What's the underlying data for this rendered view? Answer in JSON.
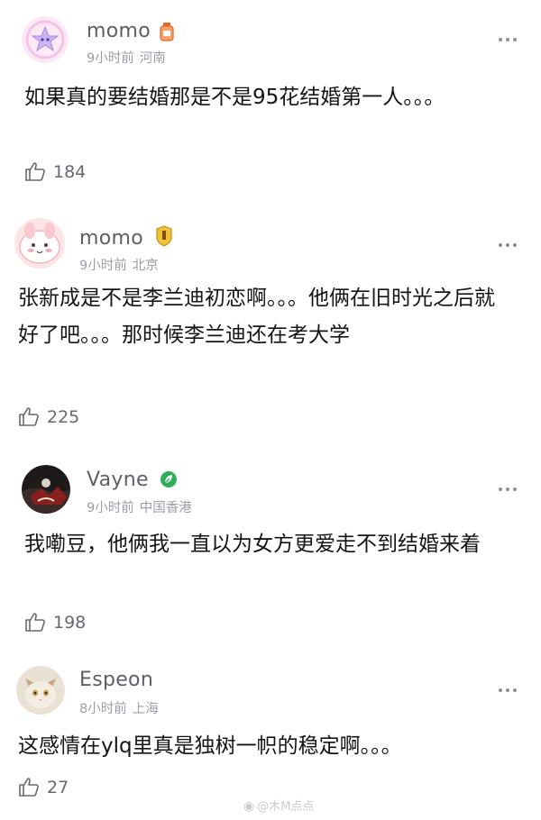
{
  "comments": [
    {
      "username": "momo",
      "time": "9小时前",
      "location": "河南",
      "text": "如果真的要结婚那是不是95花结婚第一人。。。",
      "likes": "184",
      "avatar_icon": "pastel-star-avatar",
      "badge_icon": "orange-bottle-badge-icon"
    },
    {
      "username": "momo",
      "time": "9小时前",
      "location": "北京",
      "text": "张新成是不是李兰迪初恋啊。。。他俩在旧时光之后就好了吧。。。那时候李兰迪还在考大学",
      "likes": "225",
      "avatar_icon": "pink-bunny-avatar",
      "badge_icon": "gold-shield-badge-icon"
    },
    {
      "username": "Vayne",
      "time": "9小时前",
      "location": "中国香港",
      "text": "我嘞豆，他俩我一直以为女方更爱走不到结婚来着",
      "likes": "198",
      "avatar_icon": "dark-photo-avatar",
      "badge_icon": "green-leaf-badge-icon"
    },
    {
      "username": "Espeon",
      "time": "8小时前",
      "location": "上海",
      "text": "这感情在ylq里真是独树一帜的稳定啊。。。",
      "likes": "27",
      "avatar_icon": "cat-photo-avatar",
      "badge_icon": ""
    }
  ],
  "watermark": {
    "icon": "weibo-icon",
    "text": "@木M点点"
  },
  "colors": {
    "username": "#5b5f66",
    "meta": "#9a9ea5",
    "body": "#141414",
    "badge_green": "#2fae5a",
    "badge_gold": "#d9a520",
    "badge_orange": "#e0662a"
  }
}
